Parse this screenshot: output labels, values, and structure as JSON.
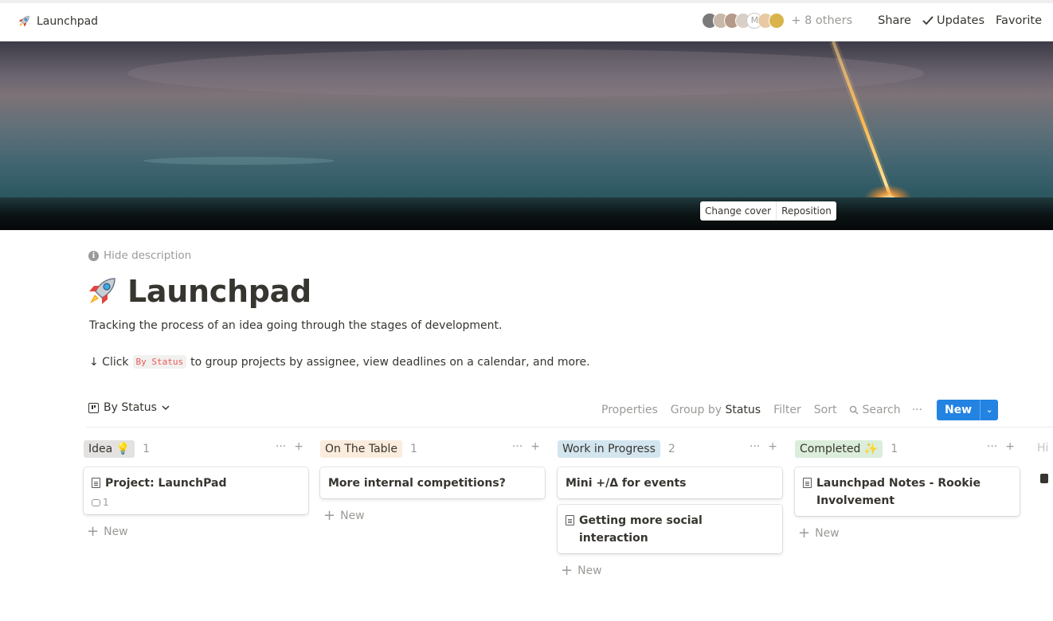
{
  "topbar": {
    "breadcrumb": "Launchpad",
    "others": "+ 8 others",
    "share": "Share",
    "updates": "Updates",
    "favorite": "Favorite",
    "avatar_letter": "M",
    "updates_icon": "check-icon"
  },
  "cover": {
    "change_cover": "Change cover",
    "reposition": "Reposition"
  },
  "page": {
    "hide_description": "Hide description",
    "title": "Launchpad",
    "title_icon": "rocket-icon",
    "description": "Tracking the process of an idea going through the stages of development.",
    "instruction_prefix": "↓ Click",
    "instruction_code": "By Status",
    "instruction_suffix": "to group projects by assignee, view deadlines on a calendar, and more."
  },
  "view": {
    "current_view": "By Status",
    "properties": "Properties",
    "group_by_label": "Group by",
    "group_by_value": "Status",
    "filter": "Filter",
    "sort": "Sort",
    "search": "Search",
    "more": "···",
    "new": "New"
  },
  "board": {
    "columns": [
      {
        "label": "Idea 💡",
        "count": "1",
        "color": "#e3e2e0",
        "cards": [
          {
            "title": "Project: LaunchPad",
            "has_doc_icon": true,
            "comments": "1"
          }
        ],
        "add_label": "New"
      },
      {
        "label": "On The Table",
        "count": "1",
        "color": "#fbecdd",
        "cards": [
          {
            "title": "More internal competitions?",
            "has_doc_icon": false
          }
        ],
        "add_label": "New"
      },
      {
        "label": "Work in Progress",
        "count": "2",
        "color": "#d3e5ef",
        "cards": [
          {
            "title": "Mini +/Δ for events",
            "has_doc_icon": false
          },
          {
            "title": "Getting more social interaction",
            "has_doc_icon": true
          }
        ],
        "add_label": "New"
      },
      {
        "label": "Completed ✨",
        "count": "1",
        "color": "#dbeddb",
        "cards": [
          {
            "title": "Launchpad Notes - Rookie Involvement",
            "has_doc_icon": true
          }
        ],
        "add_label": "New"
      }
    ],
    "hidden_label": "Hi",
    "column_ops": "···",
    "column_add": "+"
  },
  "colors": {
    "accent": "#2383e2",
    "text": "#37352f",
    "muted": "#9b9a97",
    "code_red": "#eb5757"
  }
}
